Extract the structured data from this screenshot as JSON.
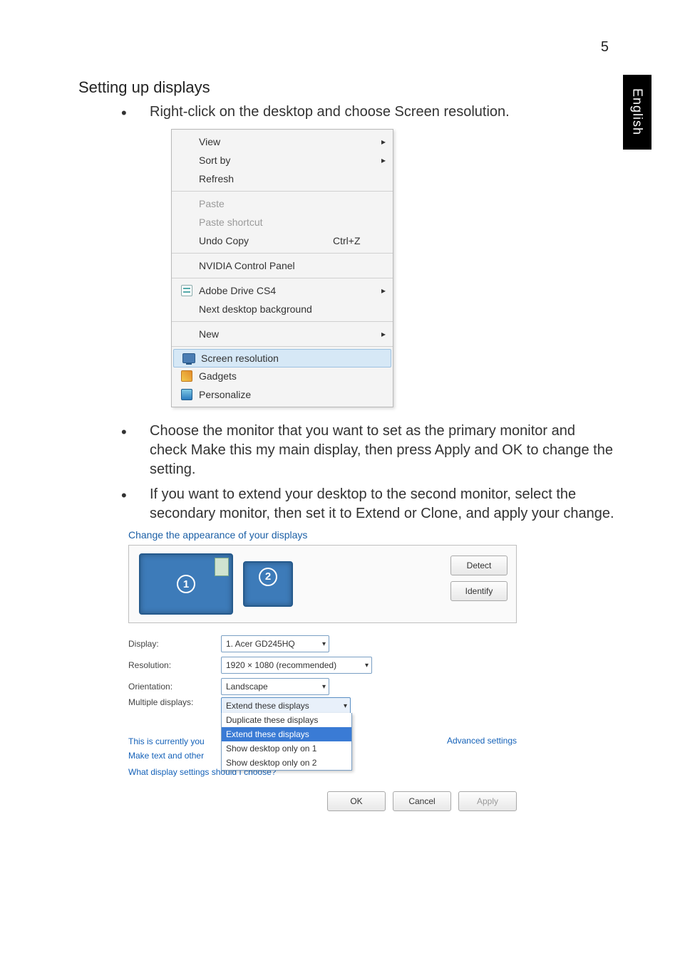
{
  "page_number": "5",
  "side_tab": "English",
  "heading": "Setting up displays",
  "bullets": {
    "b1": "Right-click on the desktop and choose Screen resolution.",
    "b2": "Choose the monitor that you want to set as the primary monitor and check Make this my main display, then press Apply and OK to change the setting.",
    "b3": "If you want to extend your desktop to the second monitor, select the secondary monitor, then set it to Extend or Clone, and apply your change."
  },
  "context_menu": {
    "view": "View",
    "sort_by": "Sort by",
    "refresh": "Refresh",
    "paste": "Paste",
    "paste_shortcut": "Paste shortcut",
    "undo_copy": "Undo Copy",
    "undo_shortcut": "Ctrl+Z",
    "nvidia": "NVIDIA Control Panel",
    "adobe": "Adobe Drive CS4",
    "next_bg": "Next desktop background",
    "new": "New",
    "screen_res": "Screen resolution",
    "gadgets": "Gadgets",
    "personalize": "Personalize",
    "arrow": "▸"
  },
  "dialog": {
    "title": "Change the appearance of your displays",
    "detect": "Detect",
    "identify": "Identify",
    "monitor1_num": "1",
    "monitor2_num": "2",
    "labels": {
      "display": "Display:",
      "resolution": "Resolution:",
      "orientation": "Orientation:",
      "multiple": "Multiple displays:"
    },
    "values": {
      "display": "1. Acer GD245HQ",
      "resolution": "1920 × 1080 (recommended)",
      "orientation": "Landscape",
      "multiple": "Extend these displays"
    },
    "multiple_options": {
      "dup": "Duplicate these displays",
      "ext": "Extend these displays",
      "only1": "Show desktop only on 1",
      "only2": "Show desktop only on 2"
    },
    "currently_prefix": "This is currently you",
    "other_items_prefix": "Make text and other",
    "advanced": "Advanced settings",
    "help": "What display settings should I choose?",
    "ok": "OK",
    "cancel": "Cancel",
    "apply": "Apply"
  }
}
